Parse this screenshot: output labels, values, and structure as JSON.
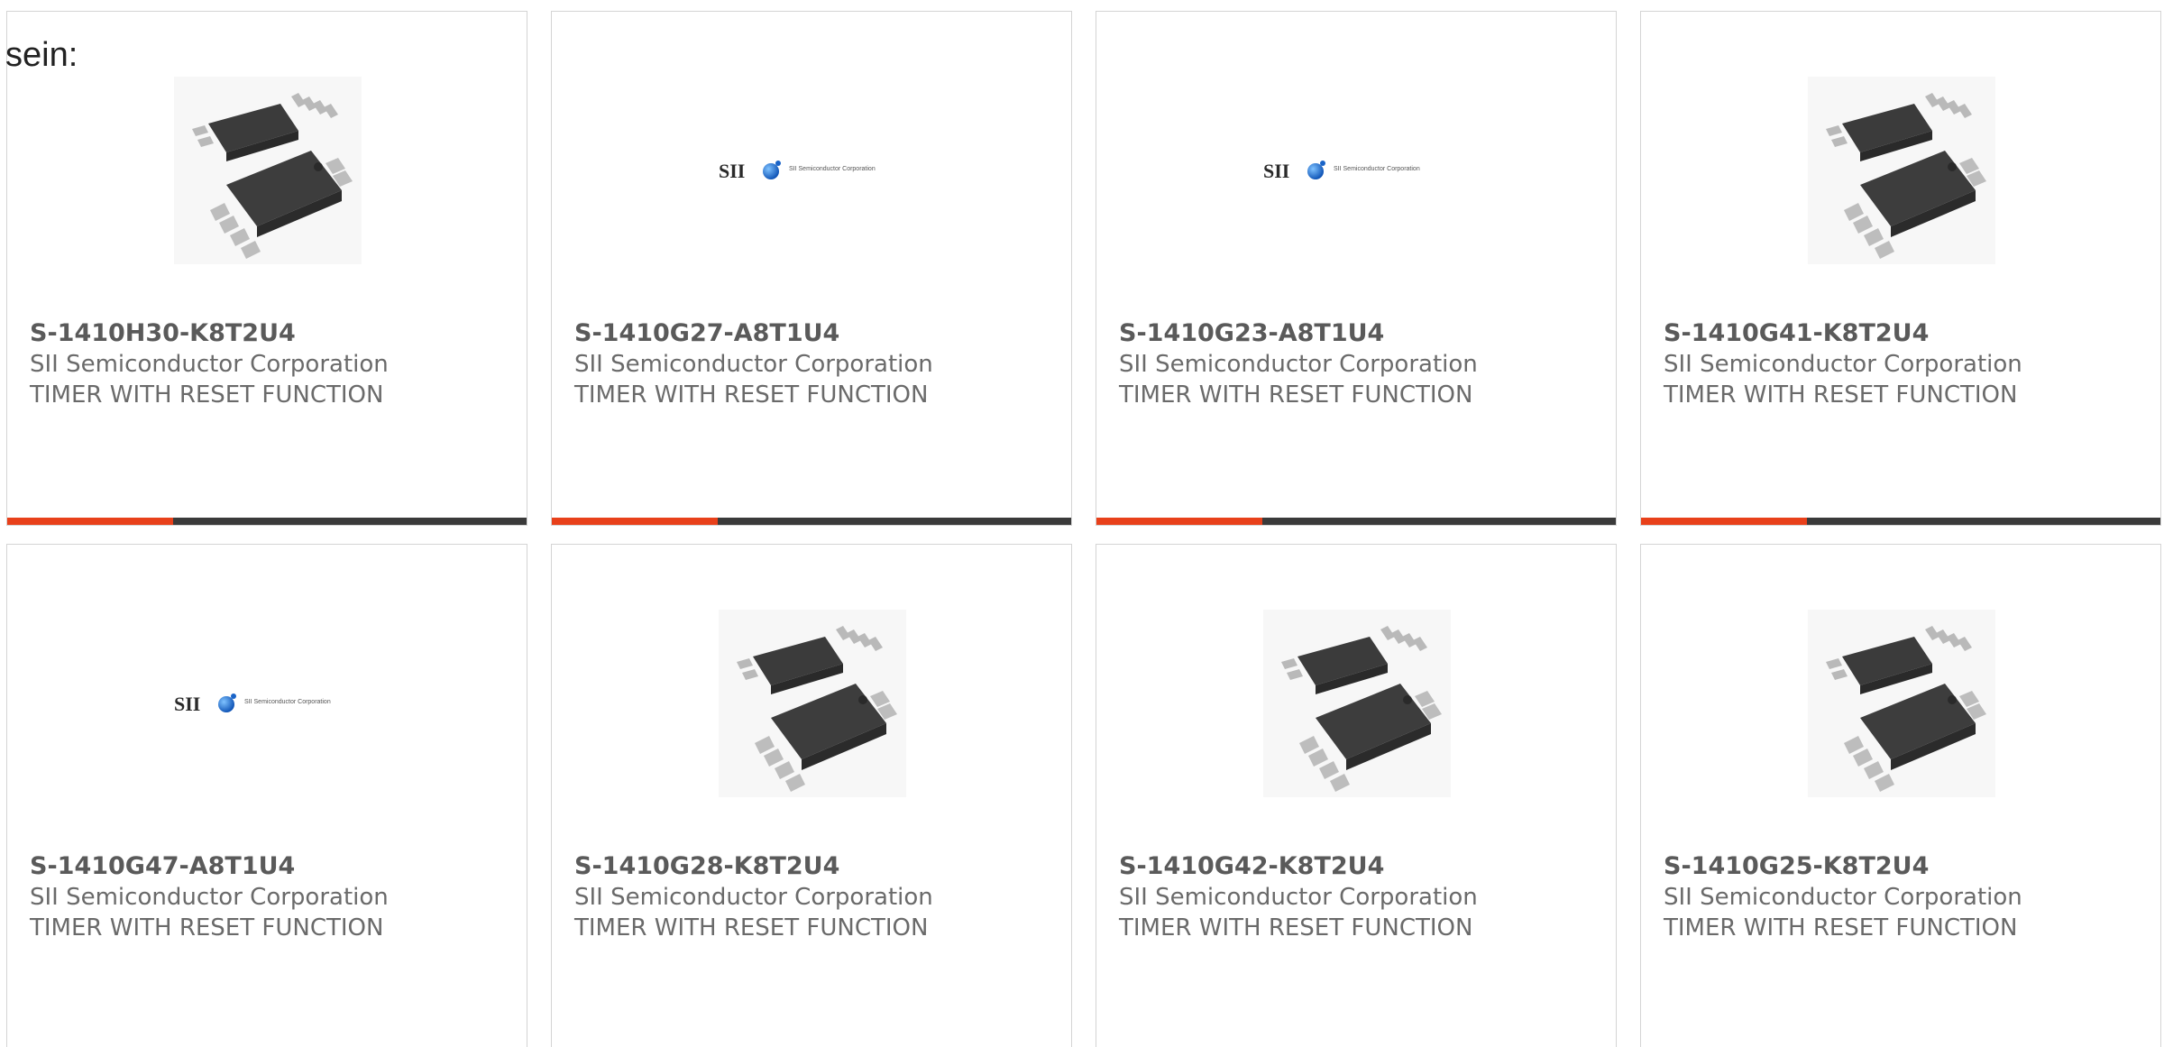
{
  "intro_text": "sein:",
  "colors": {
    "accent": "#e8401a",
    "bar": "#3a3a3a",
    "card_border": "#d4d4d4",
    "title_text": "#5a5a5a",
    "body_text": "#6a6a6a"
  },
  "cards": [
    {
      "part_number": "S-1410H30-K8T2U4",
      "manufacturer": "SII Semiconductor Corporation",
      "description": "TIMER WITH RESET FUNCTION",
      "image": "ic-package-chip-image",
      "progress_fraction": 0.32
    },
    {
      "part_number": "S-1410G27-A8T1U4",
      "manufacturer": "SII Semiconductor Corporation",
      "description": "TIMER WITH RESET FUNCTION",
      "image": "sii-logo-image",
      "logo": {
        "mark": "SII",
        "caption": "SII Semiconductor Corporation"
      },
      "progress_fraction": 0.32
    },
    {
      "part_number": "S-1410G23-A8T1U4",
      "manufacturer": "SII Semiconductor Corporation",
      "description": "TIMER WITH RESET FUNCTION",
      "image": "sii-logo-image",
      "logo": {
        "mark": "SII",
        "caption": "SII Semiconductor Corporation"
      },
      "progress_fraction": 0.32
    },
    {
      "part_number": "S-1410G41-K8T2U4",
      "manufacturer": "SII Semiconductor Corporation",
      "description": "TIMER WITH RESET FUNCTION",
      "image": "ic-package-chip-image",
      "progress_fraction": 0.32
    },
    {
      "part_number": "S-1410G47-A8T1U4",
      "manufacturer": "SII Semiconductor Corporation",
      "description": "TIMER WITH RESET FUNCTION",
      "image": "sii-logo-image",
      "logo": {
        "mark": "SII",
        "caption": "SII Semiconductor Corporation"
      }
    },
    {
      "part_number": "S-1410G28-K8T2U4",
      "manufacturer": "SII Semiconductor Corporation",
      "description": "TIMER WITH RESET FUNCTION",
      "image": "ic-package-chip-image"
    },
    {
      "part_number": "S-1410G42-K8T2U4",
      "manufacturer": "SII Semiconductor Corporation",
      "description": "TIMER WITH RESET FUNCTION",
      "image": "ic-package-chip-image"
    },
    {
      "part_number": "S-1410G25-K8T2U4",
      "manufacturer": "SII Semiconductor Corporation",
      "description": "TIMER WITH RESET FUNCTION",
      "image": "ic-package-chip-image"
    }
  ]
}
